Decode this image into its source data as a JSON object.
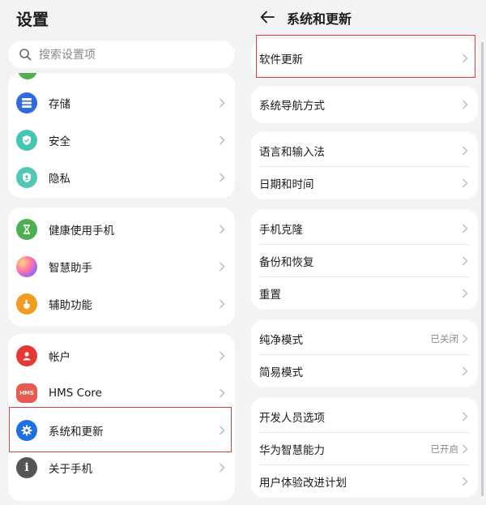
{
  "left": {
    "title": "设置",
    "search_placeholder": "搜索设置项",
    "groups": [
      {
        "items": [
          {
            "label": "存储",
            "icon": "storage-icon"
          },
          {
            "label": "安全",
            "icon": "shield-icon"
          },
          {
            "label": "隐私",
            "icon": "privacy-icon"
          }
        ]
      },
      {
        "items": [
          {
            "label": "健康使用手机",
            "icon": "hourglass-icon"
          },
          {
            "label": "智慧助手",
            "icon": "assistant-orb-icon"
          },
          {
            "label": "辅助功能",
            "icon": "hand-icon"
          }
        ]
      },
      {
        "items": [
          {
            "label": "帐户",
            "icon": "account-icon"
          },
          {
            "label": "HMS Core",
            "icon": "hms-icon",
            "icon_text": "HMS"
          },
          {
            "label": "系统和更新",
            "icon": "gear-icon",
            "selected": true
          },
          {
            "label": "关于手机",
            "icon": "info-icon",
            "icon_text": "i"
          }
        ]
      }
    ]
  },
  "right": {
    "title": "系统和更新",
    "groups": [
      {
        "items": [
          {
            "label": "软件更新",
            "highlighted": true
          }
        ]
      },
      {
        "items": [
          {
            "label": "系统导航方式"
          }
        ]
      },
      {
        "items": [
          {
            "label": "语言和输入法"
          },
          {
            "label": "日期和时间"
          }
        ]
      },
      {
        "items": [
          {
            "label": "手机克隆"
          },
          {
            "label": "备份和恢复"
          },
          {
            "label": "重置"
          }
        ]
      },
      {
        "items": [
          {
            "label": "纯净模式",
            "value": "已关闭"
          },
          {
            "label": "简易模式"
          }
        ]
      },
      {
        "items": [
          {
            "label": "开发人员选项"
          },
          {
            "label": "华为智慧能力",
            "value": "已开启"
          },
          {
            "label": "用户体验改进计划"
          }
        ]
      }
    ]
  },
  "colors": {
    "background": "#f1f3f5",
    "card": "#ffffff",
    "highlight": "#d9413a",
    "storage": "#2f6be0",
    "security": "#46c5b3",
    "privacy": "#52c7b6",
    "health": "#4caf50",
    "accessibility": "#f39a22",
    "account": "#e53935",
    "hms": "#e85a4f",
    "system": "#1e6fe0",
    "about": "#555555"
  }
}
